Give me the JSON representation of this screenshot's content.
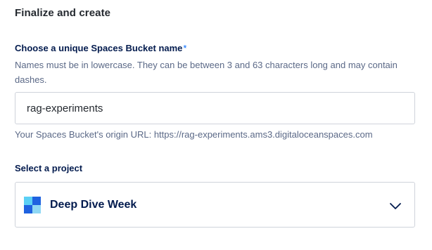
{
  "section": {
    "title": "Finalize and create"
  },
  "bucket_name": {
    "label": "Choose a unique Spaces Bucket name",
    "required_mark": "*",
    "help": "Names must be in lowercase. They can be between 3 and 63 characters long and may contain dashes.",
    "value": "rag-experiments",
    "origin_url_text": "Your Spaces Bucket's origin URL: https://rag-experiments.ams3.digitaloceanspaces.com"
  },
  "project": {
    "label": "Select a project",
    "selected": "Deep Dive Week",
    "icon": "project-grid-icon",
    "icon_colors": {
      "top_left": "#5bd0f5",
      "top_right": "#1f62e0",
      "bottom_left": "#1f62e0",
      "bottom_right": "#8fd7f4"
    },
    "dropdown_icon": "chevron-down-icon"
  },
  "colors": {
    "accent": "#0069ff",
    "text_primary": "#031b4e",
    "text_secondary": "#5b6987",
    "border": "#cfd3db"
  }
}
